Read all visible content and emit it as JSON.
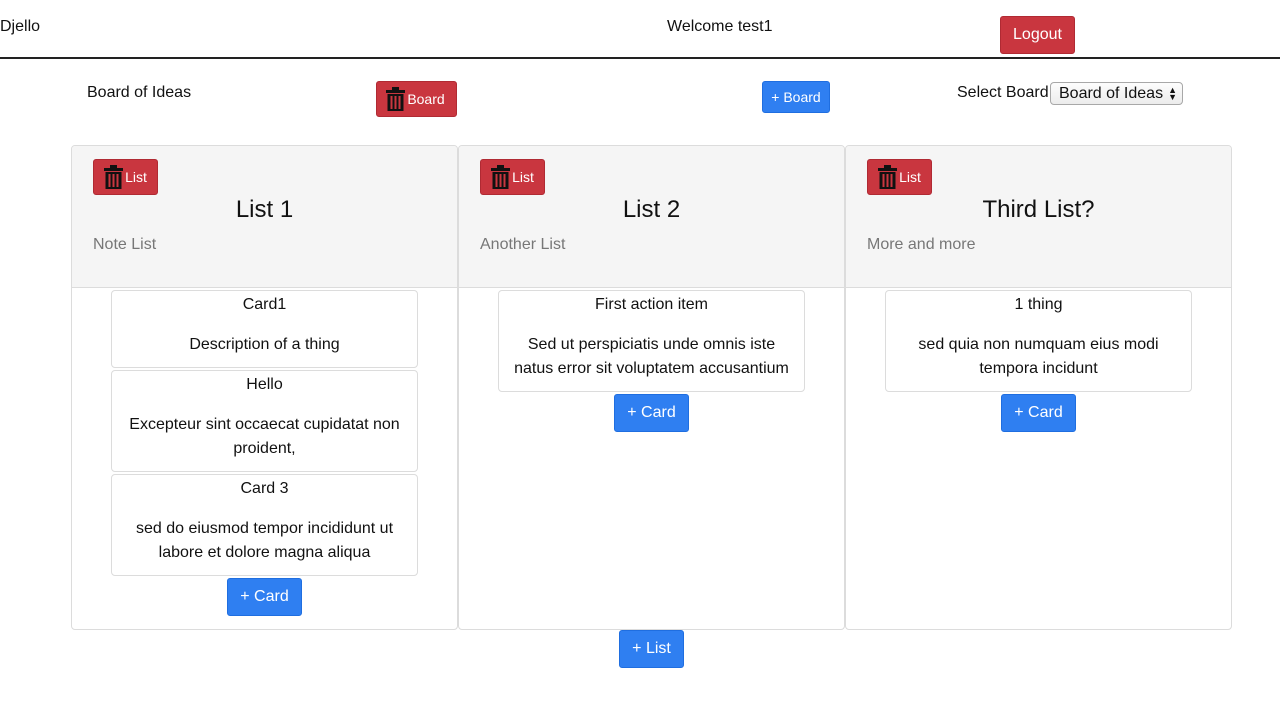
{
  "header": {
    "app_title": "Djello",
    "welcome": "Welcome test1",
    "logout_label": "Logout"
  },
  "board_bar": {
    "board_name": "Board of Ideas",
    "delete_board_label": "Board",
    "add_board_label": "+ Board",
    "select_label": "Select Board",
    "selected_board": "Board of Ideas"
  },
  "lists": [
    {
      "delete_label": "List",
      "title": "List 1",
      "description": "Note List",
      "cards": [
        {
          "title": "Card1",
          "description": "Description of a thing"
        },
        {
          "title": "Hello",
          "description": "Excepteur sint occaecat cupidatat non proident,"
        },
        {
          "title": "Card 3",
          "description": "sed do eiusmod tempor incididunt ut labore et dolore magna aliqua"
        }
      ],
      "add_card_label": "+ Card"
    },
    {
      "delete_label": "List",
      "title": "List 2",
      "description": "Another List",
      "cards": [
        {
          "title": "First action item",
          "description": "Sed ut perspiciatis unde omnis iste natus error sit voluptatem accusantium"
        }
      ],
      "add_card_label": "+ Card"
    },
    {
      "delete_label": "List",
      "title": "Third List?",
      "description": "More and more",
      "cards": [
        {
          "title": "1 thing",
          "description": "sed quia non numquam eius modi tempora incidunt"
        }
      ],
      "add_card_label": "+ Card"
    }
  ],
  "add_list_label": "+ List",
  "colors": {
    "danger": "#c9363f",
    "primary": "#2f7ff1",
    "panel_heading": "#f5f5f5",
    "muted_text": "#777777"
  },
  "icons": {
    "delete": "trash-icon"
  }
}
